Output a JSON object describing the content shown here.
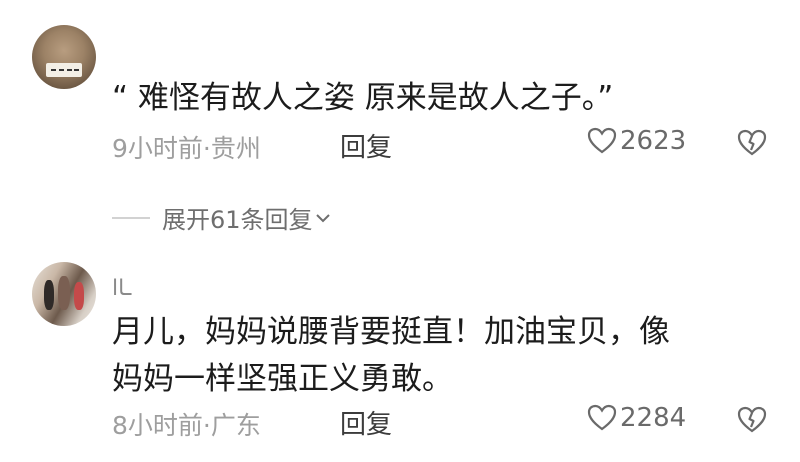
{
  "comments": [
    {
      "text_lines": [
        "“ 难怪有故人之姿  原来是故人之子。”"
      ],
      "time_location": "9小时前·贵州",
      "reply_label": "回复",
      "likes": "2623"
    },
    {
      "nickname": "ـاا",
      "text_lines": [
        "月儿，妈妈说腰背要挺直！加油宝贝，像",
        "妈妈一样坚强正义勇敢。"
      ],
      "time_location": "8小时前·广东",
      "reply_label": "回复",
      "likes": "2284"
    }
  ],
  "expand_replies": "展开61条回复",
  "icons": {
    "like": "heart-outline-icon",
    "dislike": "broken-heart-icon",
    "expand": "chevron-down-icon"
  },
  "colors": {
    "text": "#1c1c1c",
    "meta": "#9e9e9e",
    "reply": "#3c3c3c"
  }
}
